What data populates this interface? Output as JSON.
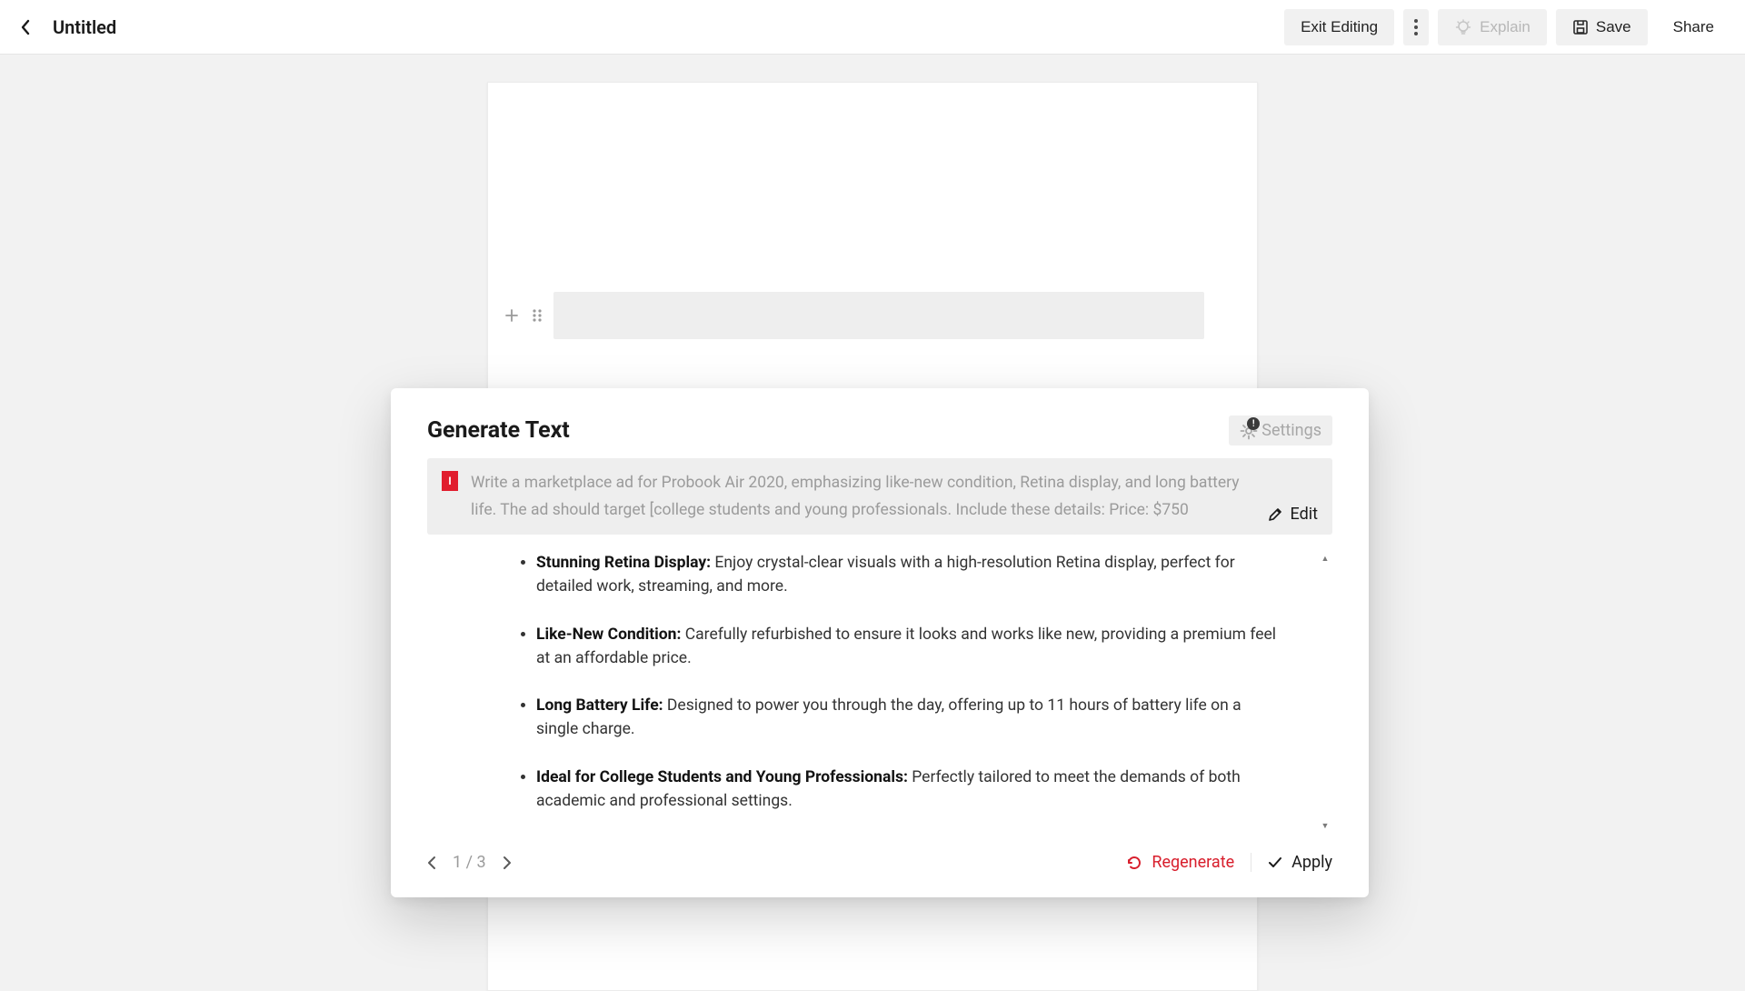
{
  "header": {
    "title": "Untitled",
    "exit_label": "Exit Editing",
    "explain_label": "Explain",
    "save_label": "Save",
    "share_label": "Share"
  },
  "panel": {
    "title": "Generate Text",
    "settings_label": "Settings",
    "settings_badge": "!",
    "prompt_marker": "I",
    "prompt_text": "Write a marketplace ad for Probook Air 2020, emphasizing like-new condition, Retina display, and long battery life. The ad should target [college students and young professionals. Include these details: Price: $750",
    "edit_label": "Edit",
    "bullets": [
      {
        "bold": "Stunning Retina Display:",
        "rest": " Enjoy crystal-clear visuals with a high-resolution Retina display, perfect for detailed work, streaming, and more."
      },
      {
        "bold": "Like-New Condition:",
        "rest": " Carefully refurbished to ensure it looks and works like new, providing a premium feel at an affordable price."
      },
      {
        "bold": "Long Battery Life:",
        "rest": " Designed to power you through the day, offering up to 11 hours of battery life on a single charge."
      },
      {
        "bold": "Ideal for College Students and Young Professionals:",
        "rest": " Perfectly tailored to meet the demands of both academic and professional settings."
      }
    ],
    "pager": {
      "current": 1,
      "total": 3
    },
    "regenerate_label": "Regenerate",
    "apply_label": "Apply"
  }
}
